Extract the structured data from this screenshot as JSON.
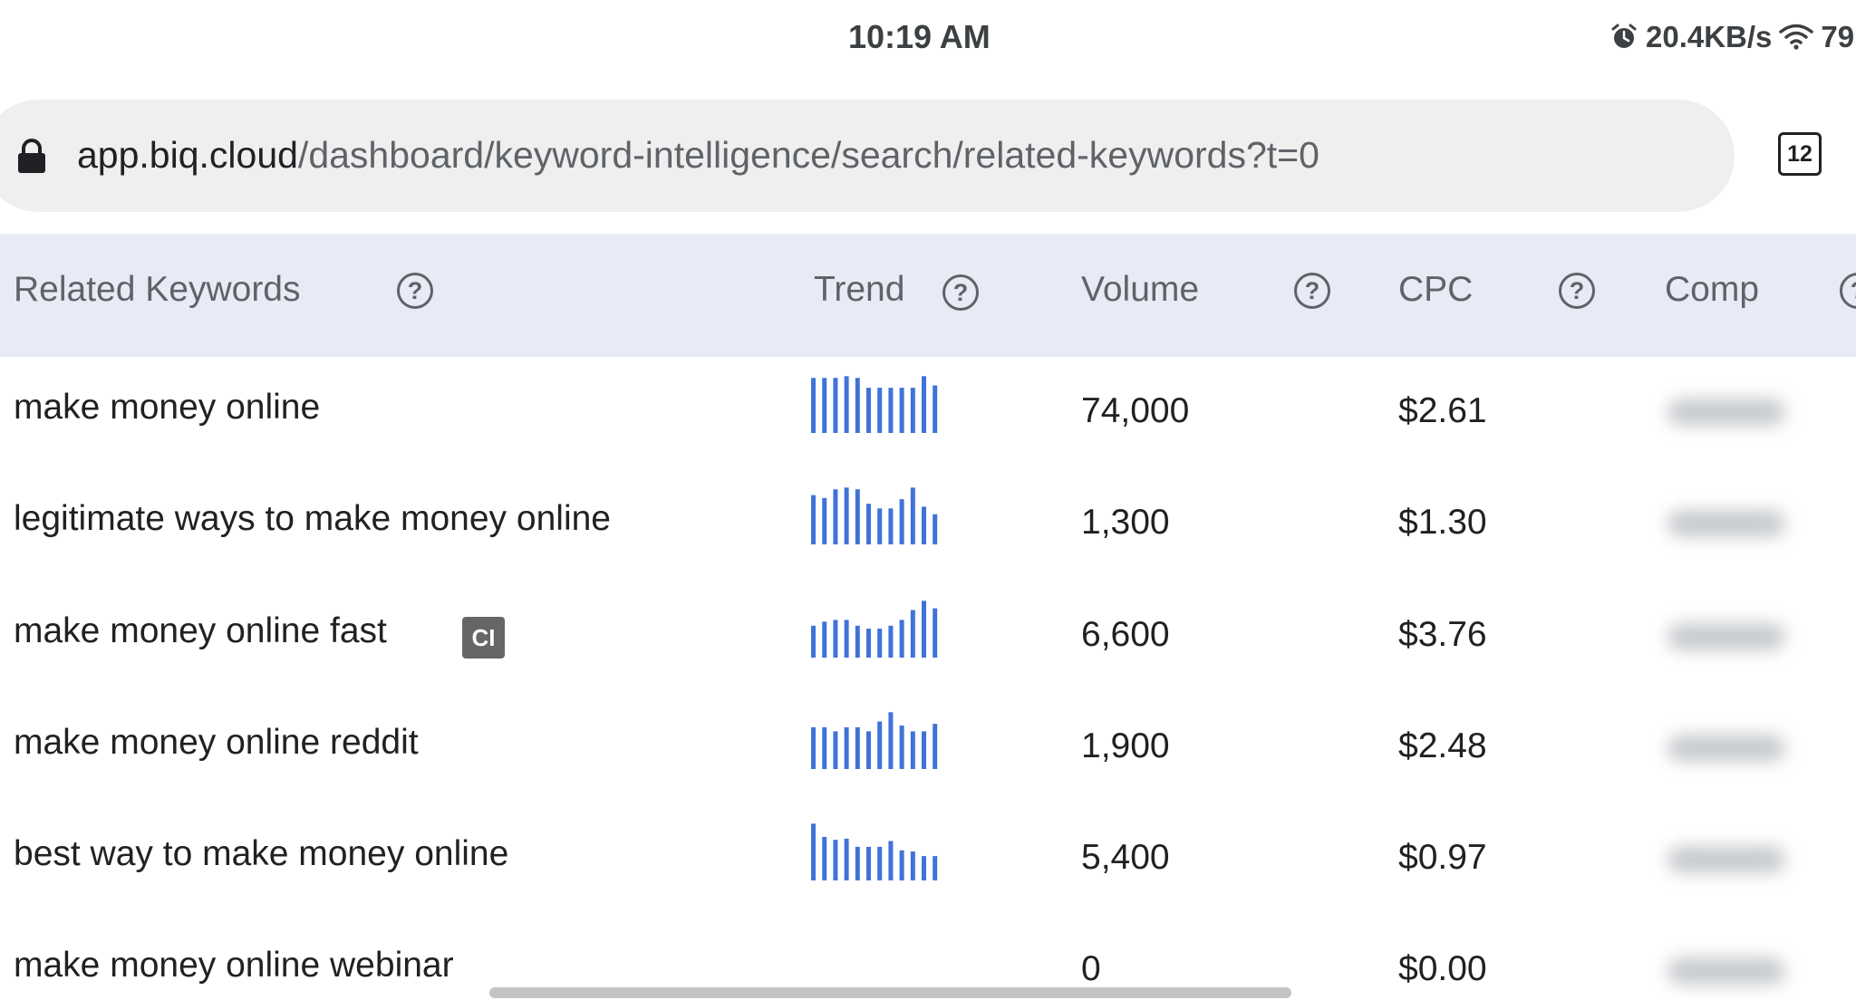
{
  "status_bar": {
    "time": "10:19 AM",
    "network_speed": "20.4KB/s",
    "battery": "79"
  },
  "browser": {
    "url_domain": "app.biq.cloud",
    "url_path": "/dashboard/keyword-intelligence/search/related-keywords?t=0",
    "tab_count": "12"
  },
  "table": {
    "headers": {
      "keyword": "Related Keywords",
      "trend": "Trend",
      "volume": "Volume",
      "cpc": "CPC",
      "comp": "Comp"
    },
    "rows": [
      {
        "keyword": "make money online",
        "volume": "74,000",
        "cpc": "$2.61",
        "trend": [
          0.95,
          0.95,
          0.95,
          0.98,
          0.95,
          0.78,
          0.78,
          0.78,
          0.78,
          0.78,
          0.98,
          0.82
        ]
      },
      {
        "keyword": "legitimate ways to make money online",
        "volume": "1,300",
        "cpc": "$1.30",
        "trend": [
          0.85,
          0.8,
          0.95,
          0.98,
          0.95,
          0.7,
          0.62,
          0.62,
          0.78,
          0.98,
          0.65,
          0.52
        ]
      },
      {
        "keyword": "make money online fast",
        "badge": "CI",
        "volume": "6,600",
        "cpc": "$3.76",
        "trend": [
          0.55,
          0.62,
          0.65,
          0.65,
          0.55,
          0.5,
          0.5,
          0.55,
          0.65,
          0.82,
          0.98,
          0.85
        ]
      },
      {
        "keyword": "make money online reddit",
        "volume": "1,900",
        "cpc": "$2.48",
        "trend": [
          0.72,
          0.72,
          0.65,
          0.72,
          0.72,
          0.65,
          0.82,
          0.98,
          0.75,
          0.65,
          0.65,
          0.78
        ]
      },
      {
        "keyword": "best way to make money online",
        "volume": "5,400",
        "cpc": "$0.97",
        "trend": [
          0.98,
          0.75,
          0.7,
          0.72,
          0.58,
          0.58,
          0.58,
          0.68,
          0.52,
          0.5,
          0.42,
          0.42
        ]
      },
      {
        "keyword": "make money online webinar",
        "volume": "0",
        "cpc": "$0.00",
        "trend": []
      }
    ]
  },
  "colors": {
    "trend_bar": "#3f73d9",
    "header_background": "#e8ebf6",
    "url_bar_background": "#efefef"
  }
}
